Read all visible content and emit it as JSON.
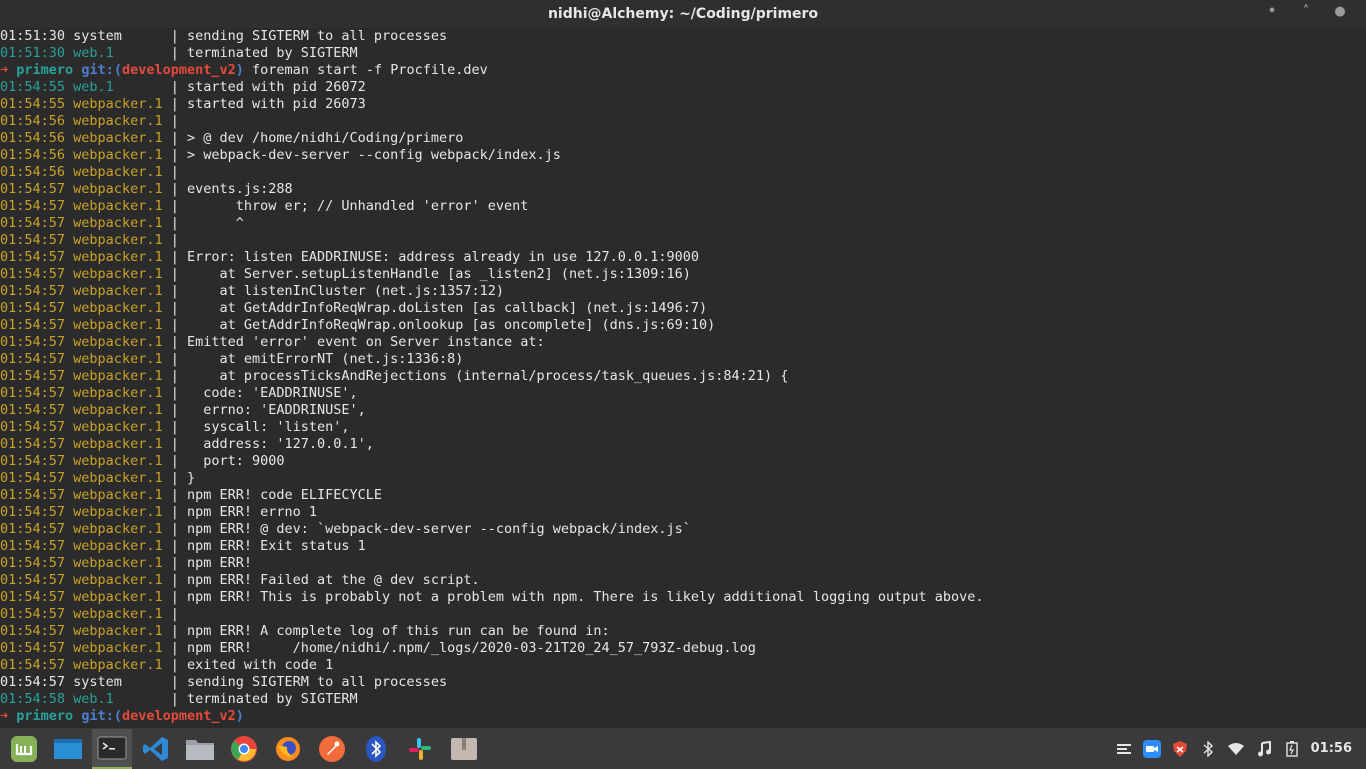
{
  "window": {
    "title": "nidhi@Alchemy: ~/Coding/primero",
    "minimize": "•",
    "maximize": "˄",
    "close": "●"
  },
  "terminal": {
    "lines": [
      {
        "kind": "log",
        "ts": "01:51:30",
        "proc": "system      ",
        "pc": "sys",
        "msg": "sending SIGTERM to all processes"
      },
      {
        "kind": "log",
        "ts": "01:51:30",
        "proc": "web.1       ",
        "pc": "web",
        "msg": "terminated by SIGTERM"
      },
      {
        "kind": "prompt",
        "arrow": "➜",
        "dir": "primero",
        "git": "git:(",
        "branch": "development_v2",
        "close": ")",
        "cmd": "foreman start -f Procfile.dev"
      },
      {
        "kind": "log",
        "ts": "01:54:55",
        "proc": "web.1       ",
        "pc": "web",
        "msg": "started with pid 26072"
      },
      {
        "kind": "log",
        "ts": "01:54:55",
        "proc": "webpacker.1 ",
        "pc": "wp",
        "msg": "started with pid 26073"
      },
      {
        "kind": "log",
        "ts": "01:54:56",
        "proc": "webpacker.1 ",
        "pc": "wp",
        "msg": ""
      },
      {
        "kind": "log",
        "ts": "01:54:56",
        "proc": "webpacker.1 ",
        "pc": "wp",
        "msg": "> @ dev /home/nidhi/Coding/primero"
      },
      {
        "kind": "log",
        "ts": "01:54:56",
        "proc": "webpacker.1 ",
        "pc": "wp",
        "msg": "> webpack-dev-server --config webpack/index.js"
      },
      {
        "kind": "log",
        "ts": "01:54:56",
        "proc": "webpacker.1 ",
        "pc": "wp",
        "msg": ""
      },
      {
        "kind": "log",
        "ts": "01:54:57",
        "proc": "webpacker.1 ",
        "pc": "wp",
        "msg": "events.js:288"
      },
      {
        "kind": "log",
        "ts": "01:54:57",
        "proc": "webpacker.1 ",
        "pc": "wp",
        "msg": "      throw er; // Unhandled 'error' event"
      },
      {
        "kind": "log",
        "ts": "01:54:57",
        "proc": "webpacker.1 ",
        "pc": "wp",
        "msg": "      ^"
      },
      {
        "kind": "log",
        "ts": "01:54:57",
        "proc": "webpacker.1 ",
        "pc": "wp",
        "msg": ""
      },
      {
        "kind": "log",
        "ts": "01:54:57",
        "proc": "webpacker.1 ",
        "pc": "wp",
        "msg": "Error: listen EADDRINUSE: address already in use 127.0.0.1:9000"
      },
      {
        "kind": "log",
        "ts": "01:54:57",
        "proc": "webpacker.1 ",
        "pc": "wp",
        "msg": "    at Server.setupListenHandle [as _listen2] (net.js:1309:16)"
      },
      {
        "kind": "log",
        "ts": "01:54:57",
        "proc": "webpacker.1 ",
        "pc": "wp",
        "msg": "    at listenInCluster (net.js:1357:12)"
      },
      {
        "kind": "log",
        "ts": "01:54:57",
        "proc": "webpacker.1 ",
        "pc": "wp",
        "msg": "    at GetAddrInfoReqWrap.doListen [as callback] (net.js:1496:7)"
      },
      {
        "kind": "log",
        "ts": "01:54:57",
        "proc": "webpacker.1 ",
        "pc": "wp",
        "msg": "    at GetAddrInfoReqWrap.onlookup [as oncomplete] (dns.js:69:10)"
      },
      {
        "kind": "log",
        "ts": "01:54:57",
        "proc": "webpacker.1 ",
        "pc": "wp",
        "msg": "Emitted 'error' event on Server instance at:"
      },
      {
        "kind": "log",
        "ts": "01:54:57",
        "proc": "webpacker.1 ",
        "pc": "wp",
        "msg": "    at emitErrorNT (net.js:1336:8)"
      },
      {
        "kind": "log",
        "ts": "01:54:57",
        "proc": "webpacker.1 ",
        "pc": "wp",
        "msg": "    at processTicksAndRejections (internal/process/task_queues.js:84:21) {"
      },
      {
        "kind": "log",
        "ts": "01:54:57",
        "proc": "webpacker.1 ",
        "pc": "wp",
        "msg": "  code: 'EADDRINUSE',"
      },
      {
        "kind": "log",
        "ts": "01:54:57",
        "proc": "webpacker.1 ",
        "pc": "wp",
        "msg": "  errno: 'EADDRINUSE',"
      },
      {
        "kind": "log",
        "ts": "01:54:57",
        "proc": "webpacker.1 ",
        "pc": "wp",
        "msg": "  syscall: 'listen',"
      },
      {
        "kind": "log",
        "ts": "01:54:57",
        "proc": "webpacker.1 ",
        "pc": "wp",
        "msg": "  address: '127.0.0.1',"
      },
      {
        "kind": "log",
        "ts": "01:54:57",
        "proc": "webpacker.1 ",
        "pc": "wp",
        "msg": "  port: 9000"
      },
      {
        "kind": "log",
        "ts": "01:54:57",
        "proc": "webpacker.1 ",
        "pc": "wp",
        "msg": "}"
      },
      {
        "kind": "log",
        "ts": "01:54:57",
        "proc": "webpacker.1 ",
        "pc": "wp",
        "msg": "npm ERR! code ELIFECYCLE"
      },
      {
        "kind": "log",
        "ts": "01:54:57",
        "proc": "webpacker.1 ",
        "pc": "wp",
        "msg": "npm ERR! errno 1"
      },
      {
        "kind": "log",
        "ts": "01:54:57",
        "proc": "webpacker.1 ",
        "pc": "wp",
        "msg": "npm ERR! @ dev: `webpack-dev-server --config webpack/index.js`"
      },
      {
        "kind": "log",
        "ts": "01:54:57",
        "proc": "webpacker.1 ",
        "pc": "wp",
        "msg": "npm ERR! Exit status 1"
      },
      {
        "kind": "log",
        "ts": "01:54:57",
        "proc": "webpacker.1 ",
        "pc": "wp",
        "msg": "npm ERR!"
      },
      {
        "kind": "log",
        "ts": "01:54:57",
        "proc": "webpacker.1 ",
        "pc": "wp",
        "msg": "npm ERR! Failed at the @ dev script."
      },
      {
        "kind": "log",
        "ts": "01:54:57",
        "proc": "webpacker.1 ",
        "pc": "wp",
        "msg": "npm ERR! This is probably not a problem with npm. There is likely additional logging output above."
      },
      {
        "kind": "log",
        "ts": "01:54:57",
        "proc": "webpacker.1 ",
        "pc": "wp",
        "msg": ""
      },
      {
        "kind": "log",
        "ts": "01:54:57",
        "proc": "webpacker.1 ",
        "pc": "wp",
        "msg": "npm ERR! A complete log of this run can be found in:"
      },
      {
        "kind": "log",
        "ts": "01:54:57",
        "proc": "webpacker.1 ",
        "pc": "wp",
        "msg": "npm ERR!     /home/nidhi/.npm/_logs/2020-03-21T20_24_57_793Z-debug.log"
      },
      {
        "kind": "log",
        "ts": "01:54:57",
        "proc": "webpacker.1 ",
        "pc": "wp",
        "msg": "exited with code 1"
      },
      {
        "kind": "log",
        "ts": "01:54:57",
        "proc": "system      ",
        "pc": "sys",
        "msg": "sending SIGTERM to all processes"
      },
      {
        "kind": "log",
        "ts": "01:54:58",
        "proc": "web.1       ",
        "pc": "web",
        "msg": "terminated by SIGTERM"
      },
      {
        "kind": "prompt",
        "arrow": "➜",
        "dir": "primero",
        "git": "git:(",
        "branch": "development_v2",
        "close": ")",
        "cmd": ""
      }
    ]
  },
  "taskbar": {
    "apps": [
      {
        "name": "mint-menu-icon",
        "color": "#87b158",
        "active": false
      },
      {
        "name": "show-desktop-icon",
        "color": "#2b8fd6",
        "active": false
      },
      {
        "name": "terminal-icon",
        "color": "#3b3b3b",
        "active": true
      },
      {
        "name": "vscode-icon",
        "color": "#2d8ad6",
        "active": false
      },
      {
        "name": "files-icon",
        "color": "#9aa0a6",
        "active": false
      },
      {
        "name": "chrome-icon",
        "color": "#e8453c",
        "active": false
      },
      {
        "name": "firefox-icon",
        "color": "#ff8a1e",
        "active": false
      },
      {
        "name": "postman-icon",
        "color": "#f26b3a",
        "active": false
      },
      {
        "name": "bluetooth-app-icon",
        "color": "#2a56c6",
        "active": false
      },
      {
        "name": "slack-icon",
        "color": "#e01e5a",
        "active": false
      },
      {
        "name": "archive-icon",
        "color": "#c4b8b0",
        "active": false
      }
    ],
    "tray": {
      "clock": "01:56"
    }
  }
}
